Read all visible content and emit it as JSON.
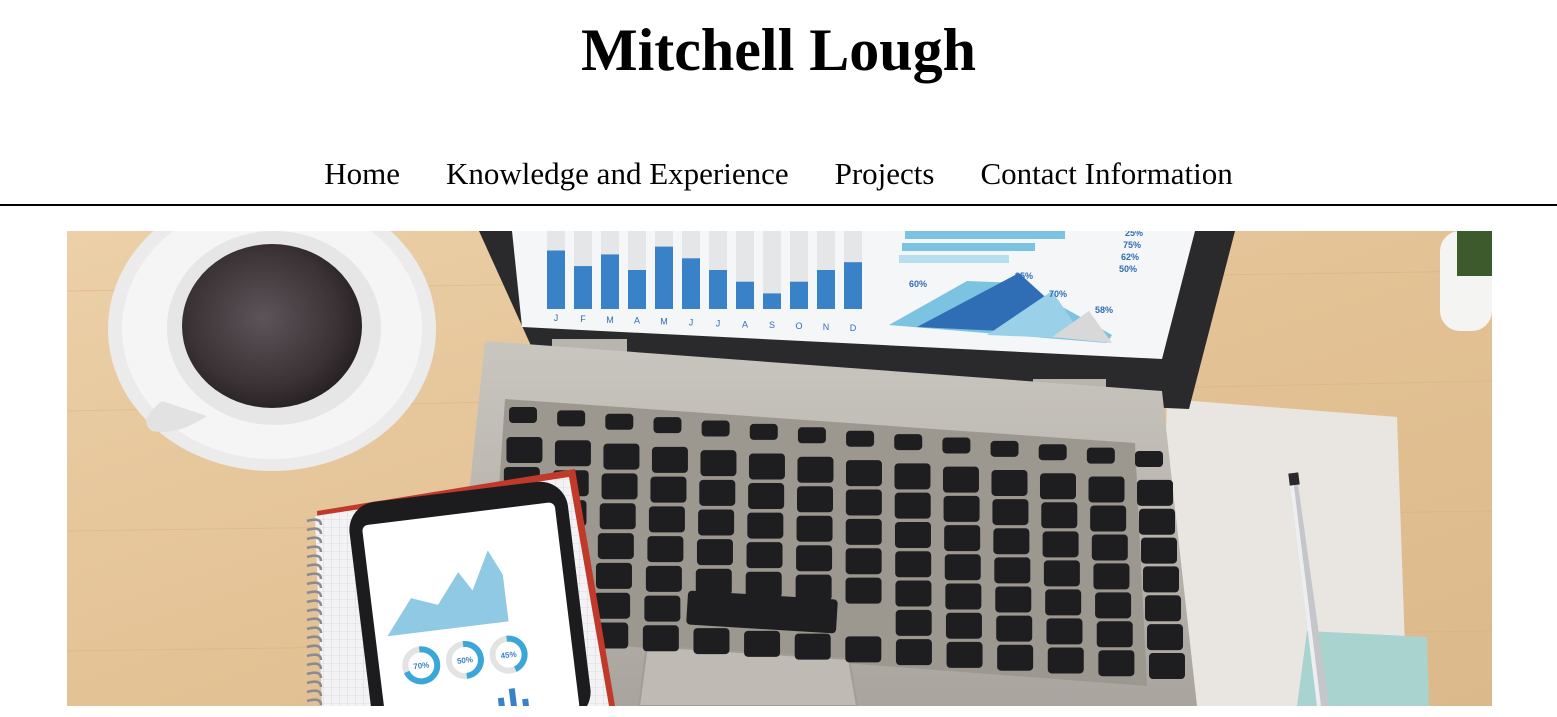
{
  "site": {
    "title": "Mitchell Lough"
  },
  "nav": {
    "items": [
      {
        "label": "Home"
      },
      {
        "label": "Knowledge and Experience"
      },
      {
        "label": "Projects"
      },
      {
        "label": "Contact Information"
      }
    ]
  },
  "hero": {
    "laptop_chart_months": [
      "J",
      "F",
      "M",
      "A",
      "M",
      "J",
      "J",
      "A",
      "S",
      "O",
      "N",
      "D"
    ],
    "laptop_bar_levels": [
      0.75,
      0.55,
      0.7,
      0.5,
      0.8,
      0.65,
      0.5,
      0.35,
      0.2,
      0.35,
      0.5,
      0.6
    ],
    "laptop_percent_labels": [
      "25%",
      "75%",
      "62%",
      "50%"
    ],
    "laptop_peak_labels": [
      "60%",
      "95%",
      "70%",
      "58%"
    ],
    "phone_ring_labels": [
      "70%",
      "50%",
      "45%"
    ],
    "colors": {
      "wood": "#e6c79e",
      "chart_blue": "#3a82c8",
      "chart_light": "#7cc3e2",
      "laptop_silver": "#b7b2ab",
      "key_black": "#1e1e20"
    }
  }
}
